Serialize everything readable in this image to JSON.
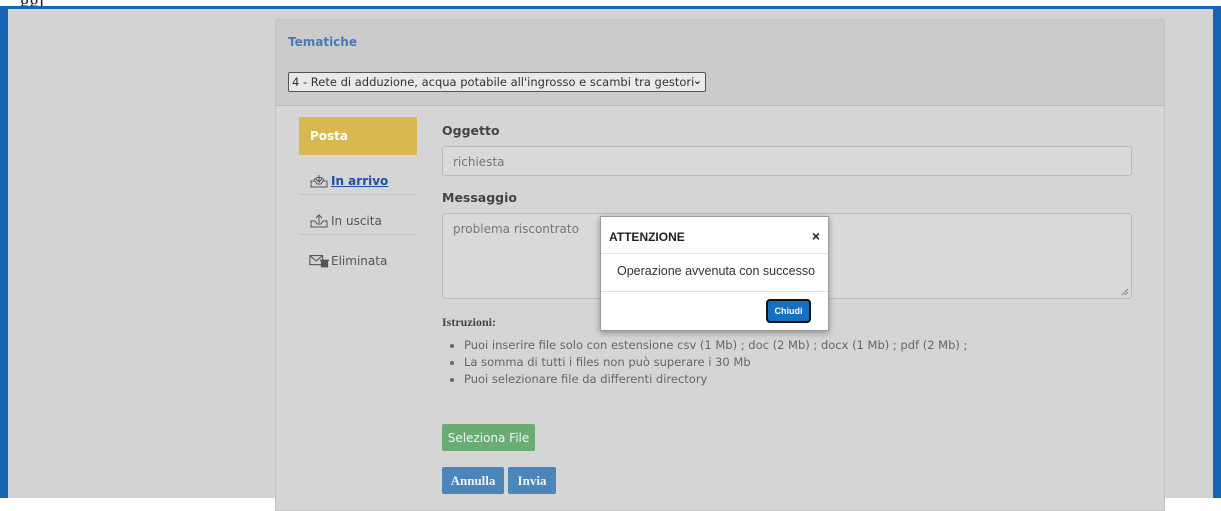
{
  "top_fragment": "ggi",
  "tematiche": {
    "label": "Tematiche",
    "selected": "4 - Rete di adduzione, acqua potabile all'ingrosso e scambi tra gestori"
  },
  "sidebar": {
    "header": "Posta",
    "items": [
      {
        "label": "In arrivo",
        "icon": "inbox-icon"
      },
      {
        "label": "In uscita",
        "icon": "outbox-icon"
      },
      {
        "label": "Eliminata",
        "icon": "trash-mail-icon"
      }
    ]
  },
  "form": {
    "oggetto_label": "Oggetto",
    "oggetto_value": "richiesta",
    "messaggio_label": "Messaggio",
    "messaggio_value": "problema riscontrato"
  },
  "istruzioni": {
    "title": "Istruzioni:",
    "items": [
      "Puoi inserire file solo con estensione csv (1 Mb) ; doc (2 Mb) ; docx (1 Mb) ; pdf (2 Mb) ;",
      "La somma di tutti i files non può superare i 30 Mb",
      "Puoi selezionare file da differenti directory"
    ]
  },
  "buttons": {
    "seleziona": "Seleziona File",
    "annulla": "Annulla",
    "invia": "Invia"
  },
  "modal": {
    "title": "ATTENZIONE",
    "close": "×",
    "message": "Operazione avvenuta con successo",
    "button": "Chiudi"
  },
  "colors": {
    "frame": "#1565b5",
    "posta_active": "#d8b84f",
    "select_button": "#69ad74",
    "action_button": "#4a86ba",
    "modal_button": "#1570c0"
  }
}
